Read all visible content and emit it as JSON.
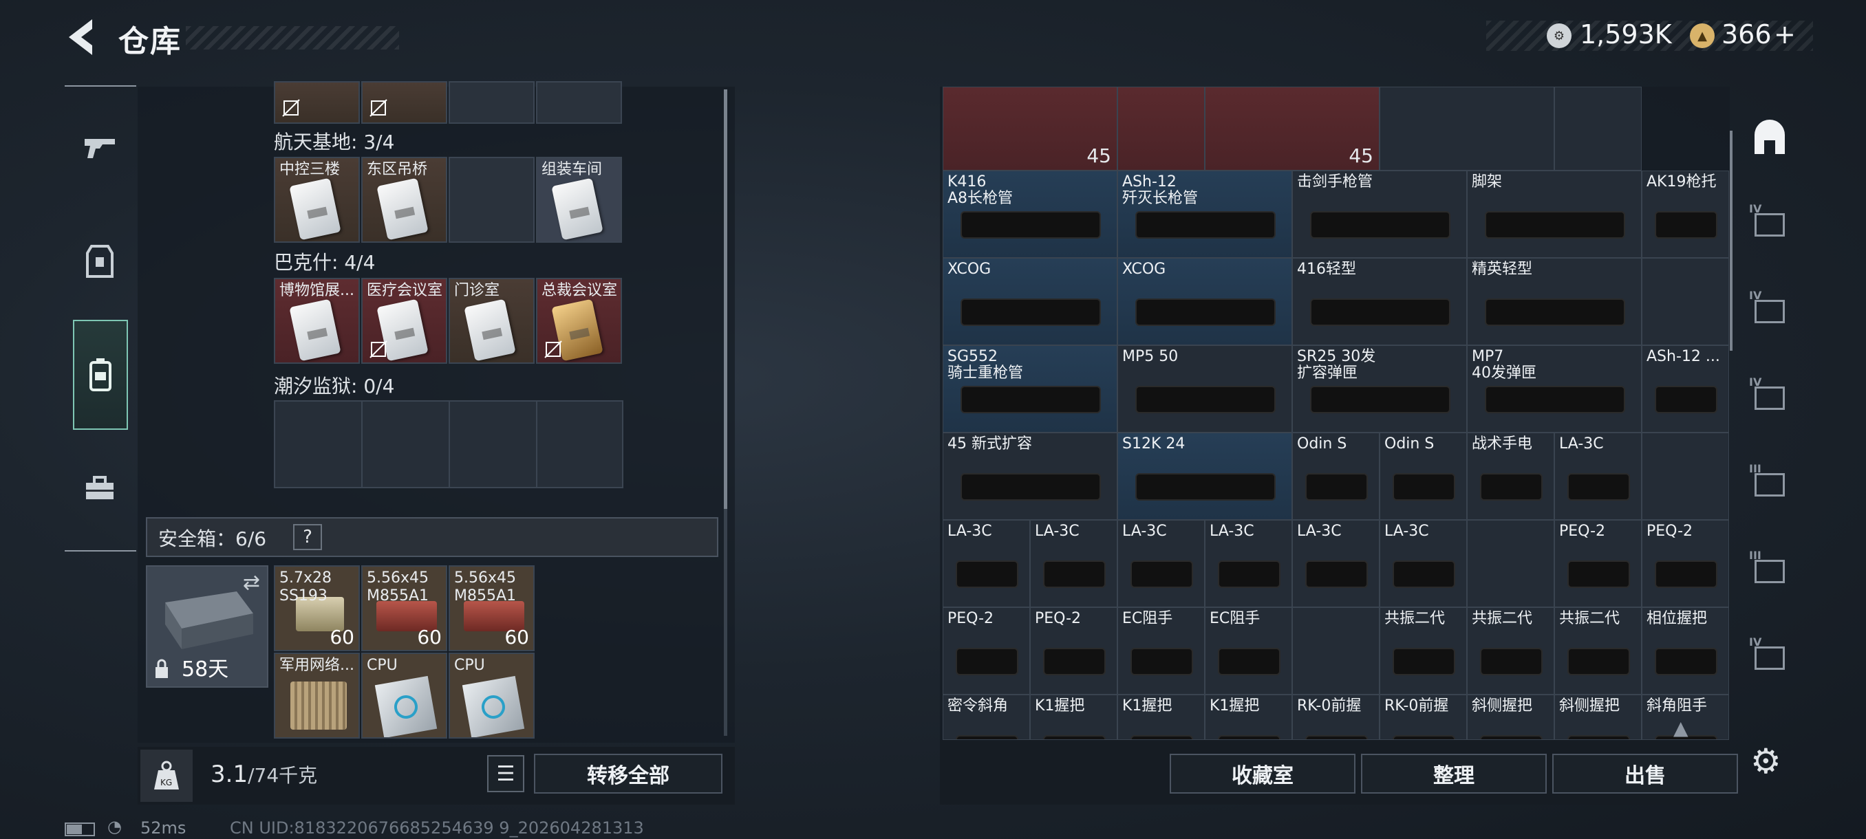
{
  "header": {
    "title": "仓库",
    "currency1": "1,593K",
    "currency2": "366",
    "plus": "+"
  },
  "sidebar": {
    "items": [
      "gun-icon",
      "armor-icon",
      "backpack-icon",
      "toolbox-icon"
    ]
  },
  "keys": {
    "sections": [
      {
        "name": "航天基地: 3/4",
        "cards": [
          "中控三楼",
          "东区吊桥",
          "",
          "组装车间"
        ]
      },
      {
        "name": "巴克什: 4/4",
        "cards": [
          "博物馆展...",
          "医疗会议室",
          "门诊室",
          "总裁会议室"
        ]
      },
      {
        "name": "潮汐监狱: 0/4",
        "cards": [
          "",
          "",
          "",
          ""
        ]
      }
    ]
  },
  "safebox": {
    "label": "安全箱：6/6",
    "help": "?",
    "days": "58天",
    "items": [
      {
        "name": "5.7x28\nSS193",
        "count": "60"
      },
      {
        "name": "5.56x45\nM855A1",
        "count": "60"
      },
      {
        "name": "5.56x45\nM855A1",
        "count": "60"
      },
      {
        "name": "军用网络...",
        "count": ""
      },
      {
        "name": "CPU",
        "count": ""
      },
      {
        "name": "CPU",
        "count": ""
      }
    ]
  },
  "footer": {
    "weight": "3.1",
    "weight_max": "/74千克",
    "transfer_all": "转移全部"
  },
  "status": {
    "ping": "52ms",
    "uid": "CN UID:8183220676685254639 9_202604281313"
  },
  "stash": {
    "top_counts": [
      "45",
      "45"
    ],
    "rows": [
      [
        "K416\nA8长枪管",
        "ASh-12\n歼灭长枪管",
        "击剑手枪管",
        "脚架",
        "AK19枪托"
      ],
      [
        "XCOG",
        "XCOG",
        "416轻型",
        "精英轻型",
        ""
      ],
      [
        "SG552\n骑士重枪管",
        "MP5 50",
        "SR25 30发\n扩容弹匣",
        "MP7\n40发弹匣",
        "ASh-12 ..."
      ],
      [
        "45 新式扩容",
        "S12K 24",
        "Odin S",
        "Odin S",
        "战术手电",
        "LA-3C",
        ""
      ],
      [
        "LA-3C",
        "LA-3C",
        "LA-3C",
        "LA-3C",
        "LA-3C",
        "LA-3C",
        "",
        "PEQ-2",
        "PEQ-2"
      ],
      [
        "PEQ-2",
        "PEQ-2",
        "EC阻手",
        "EC阻手",
        "",
        "共振二代",
        "共振二代",
        "共振二代",
        "相位握把"
      ],
      [
        "密令斜角",
        "K1握把",
        "K1握把",
        "K1握把",
        "RK-0前握",
        "RK-0前握",
        "斜侧握把",
        "斜侧握把",
        "斜角阻手"
      ]
    ],
    "buttons": {
      "collection": "收藏室",
      "sort": "整理",
      "sell": "出售"
    }
  },
  "storage_tabs": [
    "IV",
    "IV",
    "IV",
    "III",
    "III",
    "IV"
  ]
}
